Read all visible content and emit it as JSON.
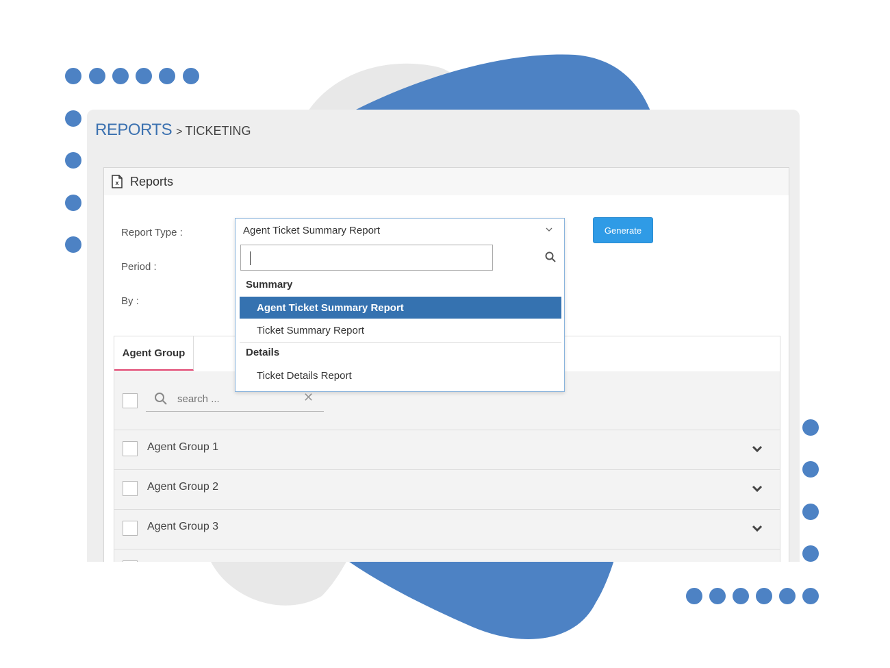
{
  "breadcrumb": {
    "root": "REPORTS",
    "separator": ">",
    "current": "TICKETING"
  },
  "panel": {
    "title": "Reports",
    "icon": "excel-file-icon"
  },
  "form": {
    "report_type_label": "Report Type :",
    "period_label": "Period :",
    "by_label": "By :",
    "generate_label": "Generate"
  },
  "dropdown": {
    "selected": "Agent Ticket Summary Report",
    "search_value": "",
    "groups": [
      {
        "label": "Summary",
        "options": [
          "Agent Ticket Summary Report",
          "Ticket Summary Report"
        ]
      },
      {
        "label": "Details",
        "options": [
          "Ticket Details Report"
        ]
      }
    ],
    "highlighted": "Agent Ticket Summary Report"
  },
  "tabs": {
    "active": "Agent Group"
  },
  "list": {
    "search_placeholder": "search ...",
    "items": [
      "Agent Group 1",
      "Agent Group 2",
      "Agent Group 3"
    ]
  },
  "colors": {
    "accent_blue": "#4d82c4",
    "highlight": "#3572b0",
    "button": "#2f9be6",
    "tab_underline": "#e0436f"
  }
}
